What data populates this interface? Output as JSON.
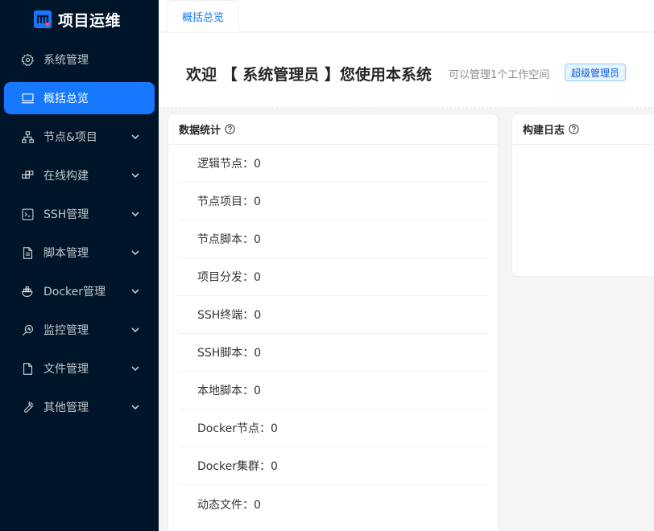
{
  "app": {
    "title": "项目运维"
  },
  "sidebar": {
    "items": [
      {
        "label": "系统管理",
        "icon": "gear-icon",
        "active": false,
        "has_submenu": false
      },
      {
        "label": "概括总览",
        "icon": "laptop-icon",
        "active": true,
        "has_submenu": false
      },
      {
        "label": "节点&项目",
        "icon": "cluster-icon",
        "active": false,
        "has_submenu": true
      },
      {
        "label": "在线构建",
        "icon": "build-icon",
        "active": false,
        "has_submenu": true
      },
      {
        "label": "SSH管理",
        "icon": "terminal-icon",
        "active": false,
        "has_submenu": true
      },
      {
        "label": "脚本管理",
        "icon": "file-text-icon",
        "active": false,
        "has_submenu": true
      },
      {
        "label": "Docker管理",
        "icon": "docker-icon",
        "active": false,
        "has_submenu": true
      },
      {
        "label": "监控管理",
        "icon": "monitor-icon",
        "active": false,
        "has_submenu": true
      },
      {
        "label": "文件管理",
        "icon": "file-icon",
        "active": false,
        "has_submenu": true
      },
      {
        "label": "其他管理",
        "icon": "tool-icon",
        "active": false,
        "has_submenu": true
      }
    ]
  },
  "tabs": [
    {
      "label": "概括总览",
      "active": true
    }
  ],
  "welcome": {
    "title": "欢迎 【 系统管理员 】您使用本系统",
    "subtitle": "可以管理1个工作空间",
    "role_tag": "超级管理员"
  },
  "stats": {
    "title": "数据统计",
    "rows": [
      "逻辑节点：0",
      "节点项目：0",
      "节点脚本：0",
      "项目分发：0",
      "SSH终端：0",
      "SSH脚本：0",
      "本地脚本：0",
      "Docker节点：0",
      "Docker集群：0",
      "动态文件：0"
    ]
  },
  "build_log": {
    "title": "构建日志"
  },
  "colors": {
    "sidebar_bg": "#001529",
    "accent": "#1677ff",
    "tag_bg": "#e6f4ff",
    "tag_text": "#0958d9"
  }
}
